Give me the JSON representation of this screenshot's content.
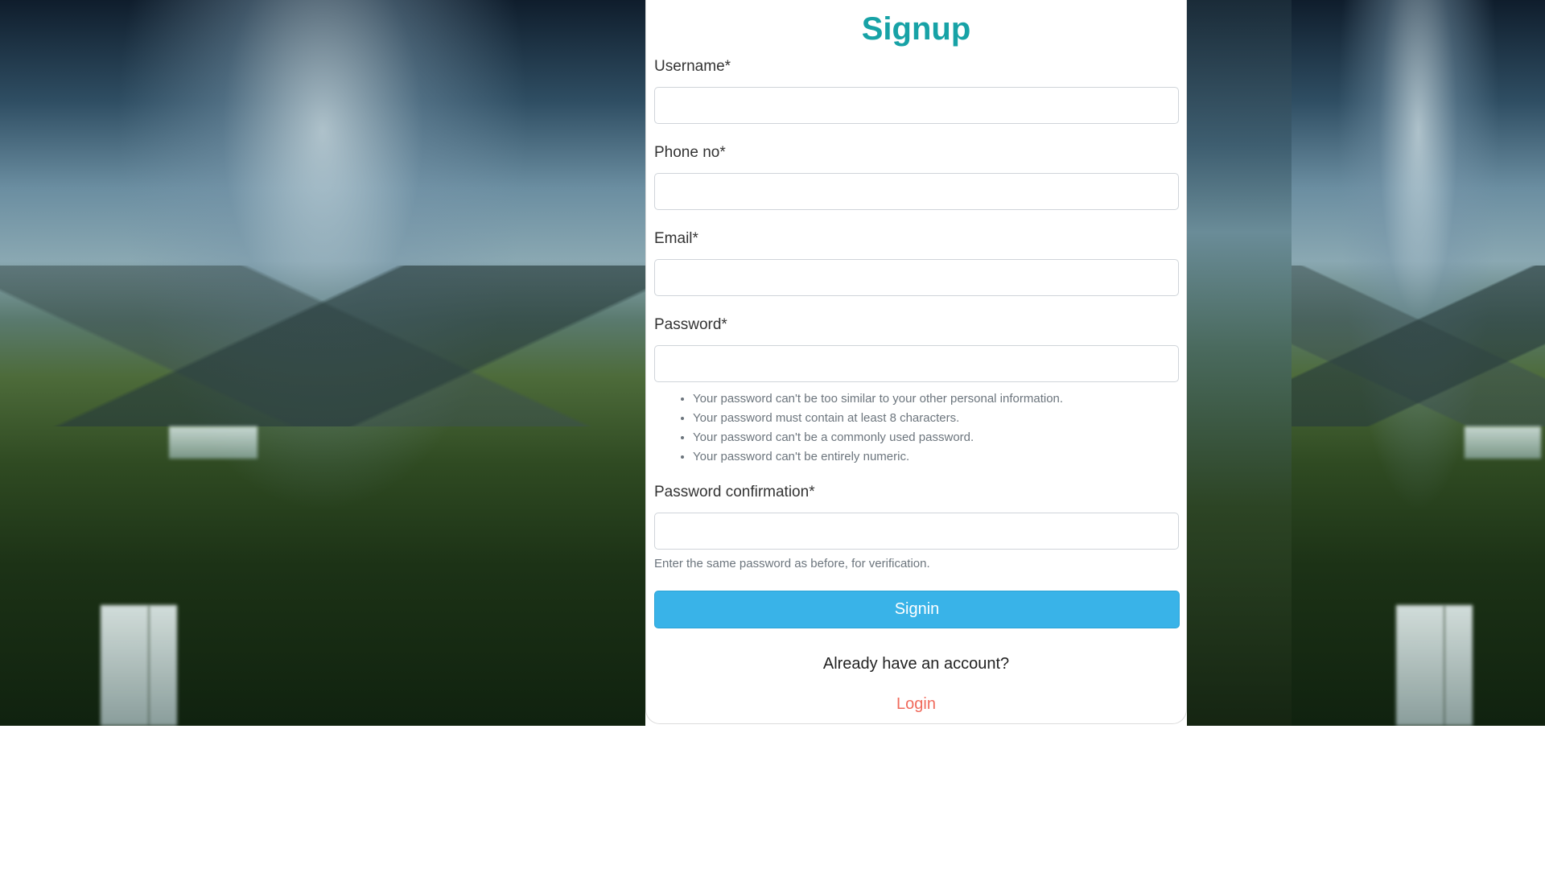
{
  "form": {
    "title": "Signup",
    "fields": [
      {
        "label": "Username*",
        "value": ""
      },
      {
        "label": "Phone no*",
        "value": ""
      },
      {
        "label": "Email*",
        "value": ""
      },
      {
        "label": "Password*",
        "value": ""
      },
      {
        "label": "Password confirmation*",
        "value": ""
      }
    ],
    "password_help": [
      "Your password can't be too similar to your other personal information.",
      "Your password must contain at least 8 characters.",
      "Your password can't be a commonly used password.",
      "Your password can't be entirely numeric."
    ],
    "confirmation_help": "Enter the same password as before, for verification.",
    "submit_label": "Signin",
    "already_text": "Already have an account?",
    "login_label": "Login"
  },
  "colors": {
    "title": "#17a2a6",
    "button": "#39b3e8",
    "login_link": "#f06a5c"
  }
}
